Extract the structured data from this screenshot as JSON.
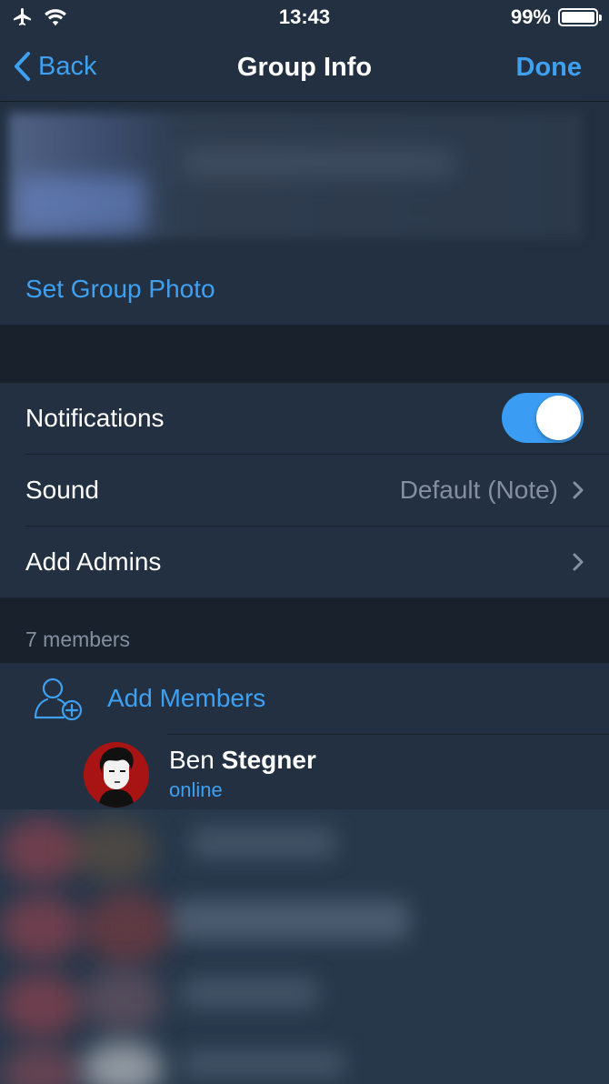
{
  "status_bar": {
    "time": "13:43",
    "battery_percent": "99%",
    "icons": [
      "airplane-icon",
      "wifi-icon",
      "battery-icon"
    ]
  },
  "nav": {
    "back_label": "Back",
    "title": "Group Info",
    "done_label": "Done"
  },
  "group": {
    "set_photo_label": "Set Group Photo"
  },
  "settings": {
    "notifications_label": "Notifications",
    "notifications_on": true,
    "sound_label": "Sound",
    "sound_value": "Default (Note)",
    "add_admins_label": "Add Admins"
  },
  "members": {
    "count_label": "7 members",
    "add_label": "Add Members",
    "list": [
      {
        "first_name": "Ben",
        "last_name": "Stegner",
        "status": "online"
      }
    ]
  },
  "colors": {
    "accent": "#3fa0f0",
    "background": "#223041",
    "section_gap": "#18212c",
    "secondary_text": "#8490a0"
  }
}
